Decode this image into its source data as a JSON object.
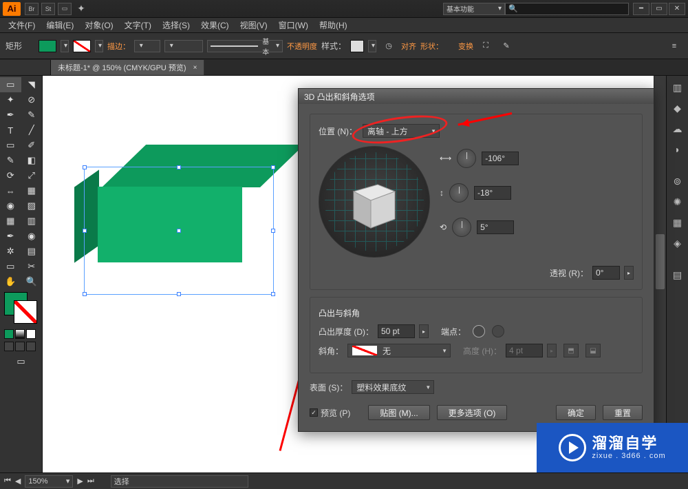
{
  "app": {
    "logo": "Ai",
    "workspace": "基本功能",
    "search_placeholder": "🔍"
  },
  "menu": [
    "文件(F)",
    "编辑(E)",
    "对象(O)",
    "文字(T)",
    "选择(S)",
    "效果(C)",
    "视图(V)",
    "窗口(W)",
    "帮助(H)"
  ],
  "control": {
    "shape_label": "矩形",
    "stroke_label": "描边：",
    "stroke_style_label": "基本",
    "opacity_label": "不透明度",
    "style_label": "样式：",
    "align_label": "对齐",
    "shape_btn": "形状：",
    "transform_label": "变换"
  },
  "doc_tab": {
    "title": "未标题-1* @ 150% (CMYK/GPU 预览)",
    "close": "×"
  },
  "dialog": {
    "title": "3D 凸出和斜角选项",
    "position_label": "位置 (N)：",
    "position_value": "离轴 - 上方",
    "angle_x": "-106°",
    "angle_y": "-18°",
    "angle_z": "5°",
    "perspective_label": "透视 (R)：",
    "perspective_value": "0°",
    "bevel_section": "凸出与斜角",
    "extrude_label": "凸出厚度 (D)：",
    "extrude_value": "50 pt",
    "cap_label": "端点：",
    "bevel_label": "斜角：",
    "bevel_value": "无",
    "height_label": "高度 (H)：",
    "height_value": "4 pt",
    "surface_label": "表面 (S)：",
    "surface_value": "塑料效果底纹",
    "preview_label": "预览 (P)",
    "map_btn": "贴图 (M)...",
    "more_btn": "更多选项 (O)",
    "ok_btn": "确定",
    "reset_btn": "重置"
  },
  "status": {
    "zoom": "150%",
    "mode": "选择"
  },
  "watermark": {
    "big": "溜溜自学",
    "small": "zixue . 3d66 . com"
  }
}
